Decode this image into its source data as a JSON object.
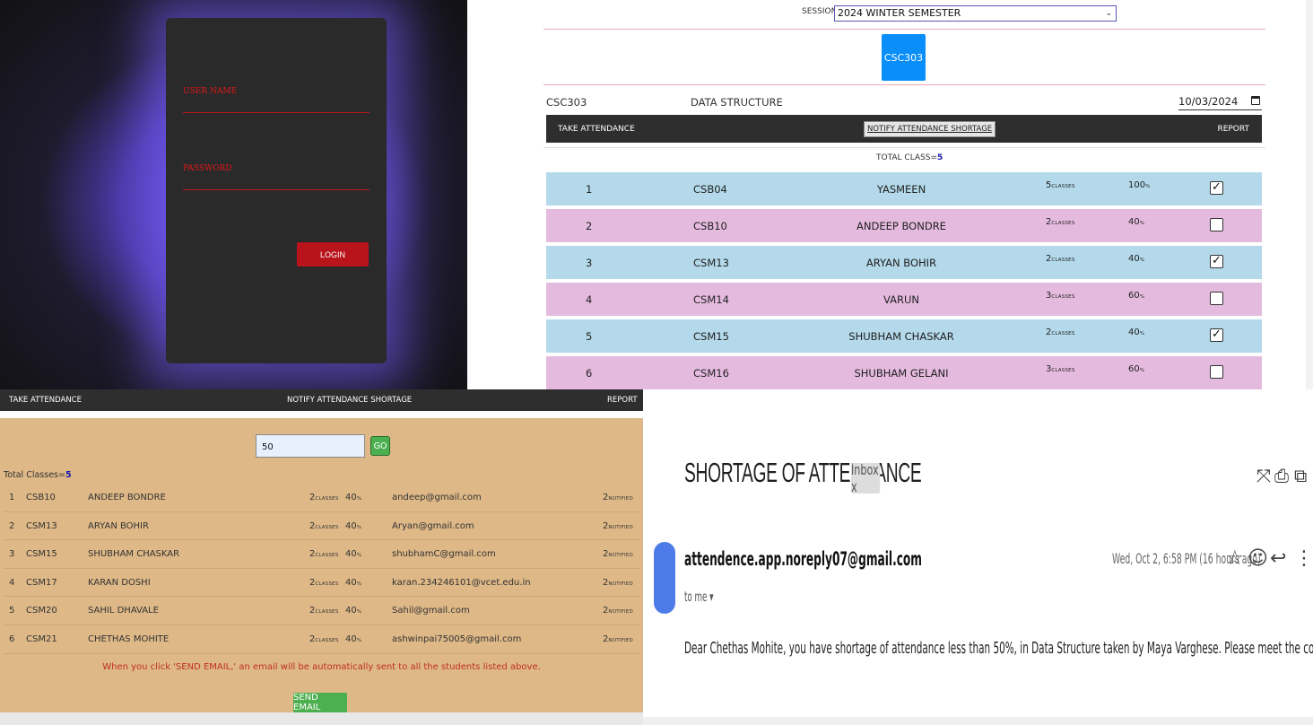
{
  "login": {
    "username_label": "USER NAME",
    "password_label": "PASSWORD",
    "login_button": "LOGIN"
  },
  "attendance": {
    "session_label": "SESSION",
    "session_value": "2024 WINTER SEMESTER",
    "course_tile": "CSC303",
    "course_code": "CSC303",
    "course_name": "DATA STRUCTURE",
    "date": "10/03/2024",
    "nav": {
      "take": "TAKE ATTENDANCE",
      "notify": "NOTIFY ATTENDANCE SHORTAGE",
      "report": "REPORT"
    },
    "total_label": "TOTAL CLASS=",
    "total_value": "5",
    "classes_unit": "CLASSES",
    "pct_unit": "%",
    "rows": [
      {
        "no": "1",
        "id": "CSB04",
        "name": "YASMEEN",
        "classes": "5",
        "pct": "100",
        "checked": true
      },
      {
        "no": "2",
        "id": "CSB10",
        "name": "ANDEEP BONDRE",
        "classes": "2",
        "pct": "40",
        "checked": false
      },
      {
        "no": "3",
        "id": "CSM13",
        "name": "ARYAN BOHIR",
        "classes": "2",
        "pct": "40",
        "checked": true
      },
      {
        "no": "4",
        "id": "CSM14",
        "name": "VARUN",
        "classes": "3",
        "pct": "60",
        "checked": false
      },
      {
        "no": "5",
        "id": "CSM15",
        "name": "SHUBHAM CHASKAR",
        "classes": "2",
        "pct": "40",
        "checked": true
      },
      {
        "no": "6",
        "id": "CSM16",
        "name": "SHUBHAM GELANI",
        "classes": "3",
        "pct": "60",
        "checked": false
      }
    ]
  },
  "shortage": {
    "nav": {
      "take": "TAKE ATTENDANCE",
      "notify": "NOTIFY ATTENDANCE SHORTAGE",
      "report": "REPORT"
    },
    "threshold_value": "50",
    "go_button": "GO",
    "total_label": "Total Classes=",
    "total_value": "5",
    "classes_unit": "CLASSES",
    "pct_unit": "%",
    "notified_unit": "NOTIFIED",
    "rows": [
      {
        "no": "1",
        "id": "CSB10",
        "name": "ANDEEP BONDRE",
        "classes": "2",
        "pct": "40",
        "email": "andeep@gmail.com",
        "notified": "2"
      },
      {
        "no": "2",
        "id": "CSM13",
        "name": "ARYAN BOHIR",
        "classes": "2",
        "pct": "40",
        "email": "Aryan@gmail.com",
        "notified": "2"
      },
      {
        "no": "3",
        "id": "CSM15",
        "name": "SHUBHAM CHASKAR",
        "classes": "2",
        "pct": "40",
        "email": "shubhamC@gmail.com",
        "notified": "2"
      },
      {
        "no": "4",
        "id": "CSM17",
        "name": "KARAN DOSHI",
        "classes": "2",
        "pct": "40",
        "email": "karan.234246101@vcet.edu.in",
        "notified": "2"
      },
      {
        "no": "5",
        "id": "CSM20",
        "name": "SAHIL DHAVALE",
        "classes": "2",
        "pct": "40",
        "email": "Sahil@gmail.com",
        "notified": "2"
      },
      {
        "no": "6",
        "id": "CSM21",
        "name": "CHETHAS MOHITE",
        "classes": "2",
        "pct": "40",
        "email": "ashwinpai75005@gmail.com",
        "notified": "2"
      }
    ],
    "note": "When you click 'SEND EMAIL,' an email will be automatically sent to all the students listed above.",
    "send_button": "SEND EMAIL"
  },
  "email": {
    "subject": "SHORTAGE OF ATTENDANCE",
    "badge": "Inbox x",
    "sender": "attendence.app.noreply07@gmail.com",
    "to": "to me ▾",
    "date": "Wed, Oct 2, 6:58 PM (16 hours ago)",
    "body": "Dear Chethas Mohite, you have shortage of attendance less than 50%, in Data Structure  taken by Maya Varghese. Please meet the corresponding faculty ASAP."
  }
}
